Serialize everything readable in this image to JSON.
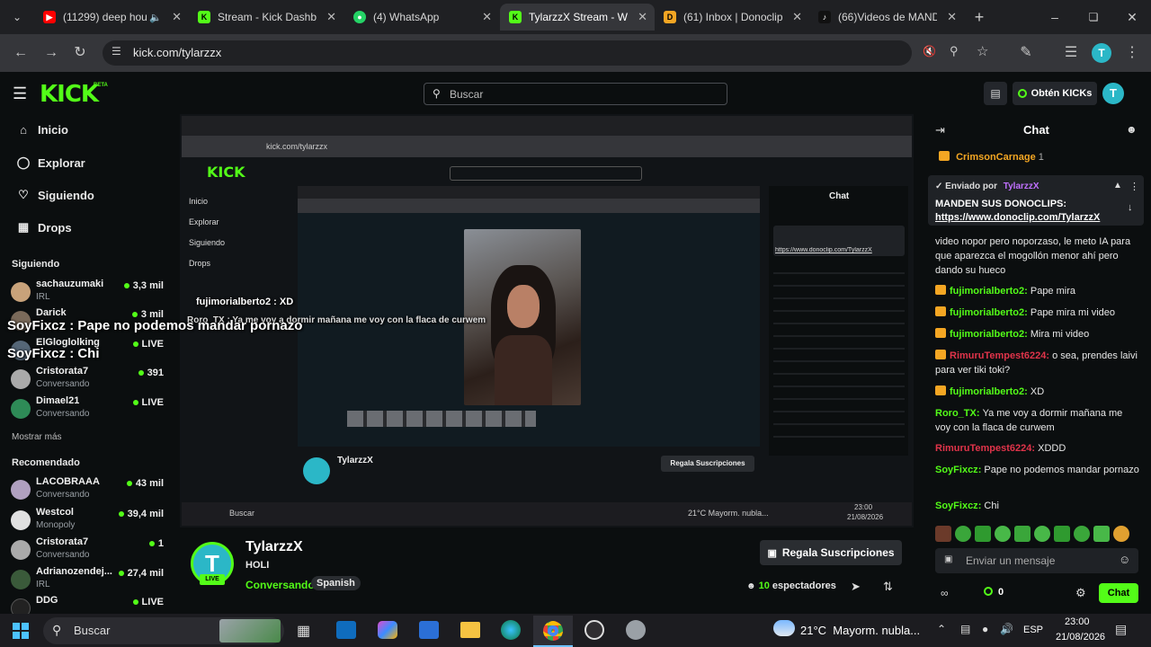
{
  "browser": {
    "tabs": [
      {
        "label": "(11299) deep hou",
        "icon": "youtube-icon",
        "color": "#ff0000"
      },
      {
        "label": "Stream - Kick Dashbo",
        "icon": "kick-icon",
        "color": "#53fc18"
      },
      {
        "label": "(4) WhatsApp",
        "icon": "whatsapp-icon",
        "color": "#25d366"
      },
      {
        "label": "TylarzzX Stream - Wa",
        "icon": "kick-icon",
        "color": "#53fc18"
      },
      {
        "label": "(61) Inbox | Donoclip",
        "icon": "donoclip-icon",
        "color": "#f4a623"
      },
      {
        "label": "(66)Videos de MAND",
        "icon": "tiktok-icon",
        "color": "#ffffff"
      }
    ],
    "url": "kick.com/tylarzzx"
  },
  "kick": {
    "logo": "KICK",
    "beta": "BETA",
    "search_placeholder": "Buscar",
    "get_kicks": "Obtén KICKs",
    "nav": [
      {
        "label": "Inicio",
        "icon": "home-icon"
      },
      {
        "label": "Explorar",
        "icon": "compass-icon"
      },
      {
        "label": "Siguiendo",
        "icon": "heart-icon"
      },
      {
        "label": "Drops",
        "icon": "drops-icon"
      }
    ],
    "following_title": "Siguiendo",
    "following": [
      {
        "name": "sachauzumaki",
        "category": "IRL",
        "viewers": "3,3 mil",
        "color": "#c8a27a"
      },
      {
        "name": "Darick",
        "category": "",
        "viewers": "3 mil",
        "color": "#7a6a5a"
      },
      {
        "name": "ElGloglolking",
        "category": "",
        "viewers": "LIVE",
        "color": "#556677"
      },
      {
        "name": "Cristorata7",
        "category": "Conversando",
        "viewers": "391",
        "color": "#aaaaaa"
      },
      {
        "name": "Dimael21",
        "category": "Conversando",
        "viewers": "LIVE",
        "color": "#2e8b57"
      }
    ],
    "show_more": "Mostrar más",
    "recommended_title": "Recomendado",
    "recommended": [
      {
        "name": "LACOBRAAA",
        "category": "Conversando",
        "viewers": "43 mil",
        "color": "#b0a0c0"
      },
      {
        "name": "Westcol",
        "category": "Monopoly",
        "viewers": "39,4 mil",
        "color": "#e0e0e0"
      },
      {
        "name": "Cristorata7",
        "category": "Conversando",
        "viewers": "1",
        "color": "#aaaaaa"
      },
      {
        "name": "Adrianozendej...",
        "category": "IRL",
        "viewers": "27,4 mil",
        "color": "#3a5a3a"
      },
      {
        "name": "DDG",
        "category": "",
        "viewers": "LIVE",
        "color": "#222222"
      }
    ]
  },
  "overlay": {
    "line1": "SoyFixcz : Pape no podemos mandar pornazo",
    "line2": "SoyFixcz : Chi",
    "inner_user": "fujimorialberto2 : XD",
    "inner_msg": "Roro_TX : Ya me voy a dormir mañana me voy con la flaca de curwem"
  },
  "streamer": {
    "name": "TylarzzX",
    "title": "HOLI",
    "category": "Conversando",
    "language": "Spanish",
    "avatar_letter": "T",
    "live_badge": "LIVE",
    "gift_button": "Regala Suscripciones",
    "viewers_count": "10",
    "viewers_label": "espectadores"
  },
  "chat": {
    "title": "Chat",
    "top_user": "CrimsonCarnage",
    "top_count": "1",
    "pinned_by_label": "Enviado por",
    "pinned_by_user": "TylarzzX",
    "pinned_text": "MANDEN SUS DONOCLIPS:",
    "pinned_link": "https://www.donoclip.com/TylarzzX",
    "partial": "video nopor pero noporzaso, le meto IA para que aparezca el mogollón menor ahí pero dando su hueco",
    "messages": [
      {
        "user": "fujimorialberto2",
        "text": "Pape mira",
        "color": "#53fc18",
        "badge": true
      },
      {
        "user": "fujimorialberto2",
        "text": "Pape mira mi video",
        "color": "#53fc18",
        "badge": true
      },
      {
        "user": "fujimorialberto2",
        "text": "Mira mi video",
        "color": "#53fc18",
        "badge": true
      },
      {
        "user": "RimuruTempest6224",
        "text": "o sea, prendes laivi para ver tiki toki?",
        "color": "#e0344a",
        "badge": true
      },
      {
        "user": "fujimorialberto2",
        "text": "XD",
        "color": "#53fc18",
        "badge": true
      },
      {
        "user": "Roro_TX",
        "text": "Ya me voy a dormir mañana me voy con la flaca de curwem",
        "color": "#53fc18",
        "badge": false
      },
      {
        "user": "RimuruTempest6224",
        "text": "XDDD",
        "color": "#e0344a",
        "badge": false
      },
      {
        "user": "SoyFixcz",
        "text": "Pape no podemos mandar pornazo",
        "color": "#53fc18",
        "badge": false
      },
      {
        "user": "SoyFixcz",
        "text": "Chi",
        "color": "#53fc18",
        "badge": false
      }
    ],
    "input_placeholder": "Enviar un mensaje",
    "kicks_count": "0",
    "send_button": "Chat"
  },
  "taskbar": {
    "search_placeholder": "Buscar",
    "weather": "21°C  Mayorm. nubla...",
    "lang": "ESP",
    "time": "23:00",
    "date": "21/08/2026"
  }
}
